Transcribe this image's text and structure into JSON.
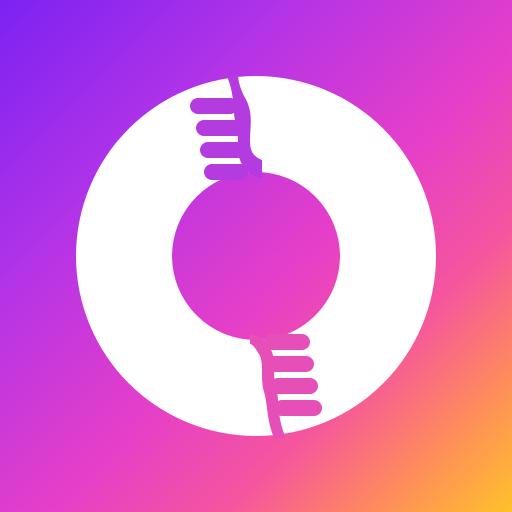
{
  "icon": {
    "name": "app-logo-icon",
    "description_kind": "logo",
    "colors": {
      "background_gradient": [
        "#7B22F2",
        "#B233E8",
        "#E63FC8",
        "#F5559E",
        "#FF8A5E",
        "#FFC12A"
      ],
      "ring": "#FFFFFF",
      "inner_gradient": [
        "#8A2BE2",
        "#D33BD6"
      ],
      "teeth_purple": "#B43BE0",
      "teeth_pink": "#E64FB8"
    }
  }
}
